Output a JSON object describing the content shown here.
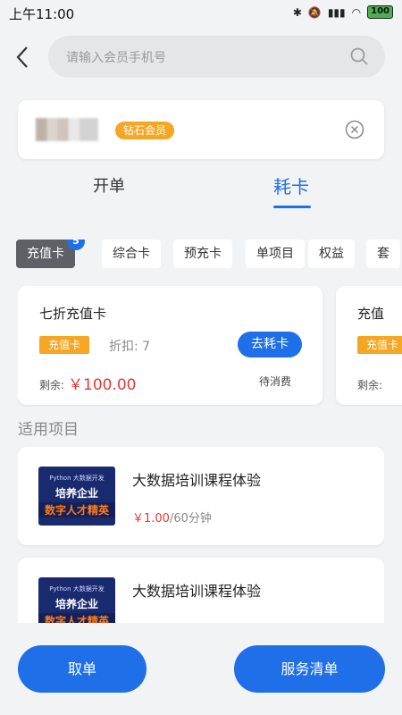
{
  "status": {
    "time": "上午11:00",
    "battery": "100"
  },
  "search": {
    "placeholder": "请输入会员手机号"
  },
  "member": {
    "level": "钻石会员"
  },
  "main_tabs": [
    {
      "label": "开单"
    },
    {
      "label": "耗卡"
    }
  ],
  "card_tabs": [
    {
      "label": "充值卡",
      "count": "5"
    },
    {
      "label": "综合卡"
    },
    {
      "label": "预充卡"
    },
    {
      "label": "单项目"
    },
    {
      "label": "权益"
    },
    {
      "label": "套"
    }
  ],
  "cards": [
    {
      "title": "七折充值卡",
      "type": "充值卡",
      "discount": "折扣: 7",
      "action": "去耗卡",
      "remain_label": "剩余:",
      "remain_amount": "￥100.00",
      "status": "待消费"
    },
    {
      "title": "充值",
      "type": "充值卡",
      "remain_label": "剩余:"
    }
  ],
  "section": {
    "title": "适用项目"
  },
  "items": [
    {
      "thumb": {
        "line1": "Python 大数据开发",
        "line2": "培养企业",
        "line3": "数字人才精英"
      },
      "title": "大数据培训课程体验",
      "price": "￥1.00",
      "duration": "/60分钟"
    },
    {
      "thumb": {
        "line1": "Python 大数据开发",
        "line2": "培养企业",
        "line3": "数字人才精英"
      },
      "title": "大数据培训课程体验"
    }
  ],
  "bottom": {
    "cancel": "取单",
    "service_list": "服务清单"
  },
  "colors": {
    "accent": "#1f6fe8",
    "orange": "#f5a623",
    "price_red": "#e03b3b"
  }
}
